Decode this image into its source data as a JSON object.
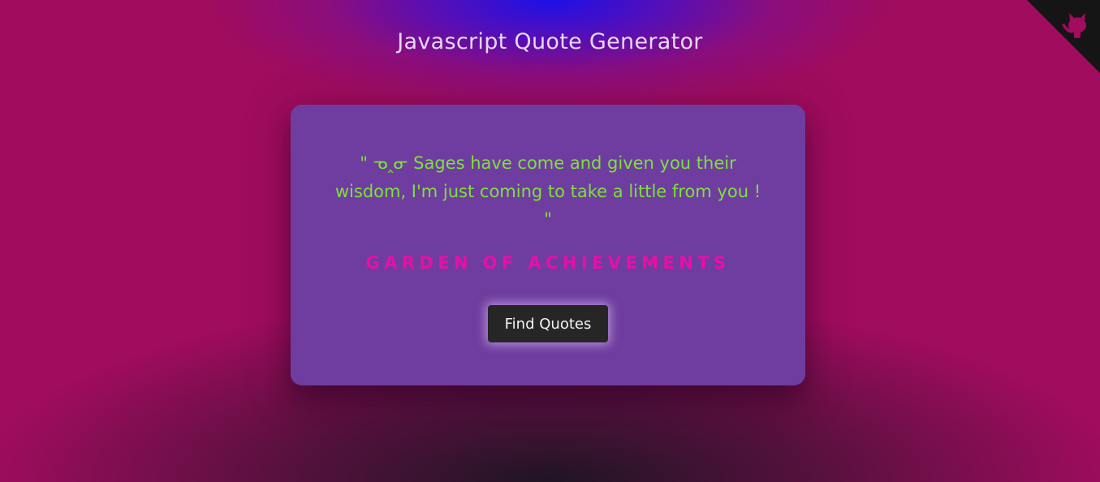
{
  "header": {
    "title": "Javascript Quote Generator"
  },
  "quote_card": {
    "quote_text": "\" ᓀ‸ᓂ Sages have come and given you their wisdom, I'm just coming to take a little from you ! \"",
    "author": "GARDEN OF ACHIEVEMENTS",
    "button_label": "Find Quotes"
  },
  "corner": {
    "icon": "github-octocat-icon"
  },
  "colors": {
    "quote_text": "#7ee03c",
    "author": "#e80fa5",
    "card_background": "#6f3d9f",
    "button_background": "#262626",
    "corner_background": "#151515",
    "corner_icon": "#a00c5e"
  }
}
